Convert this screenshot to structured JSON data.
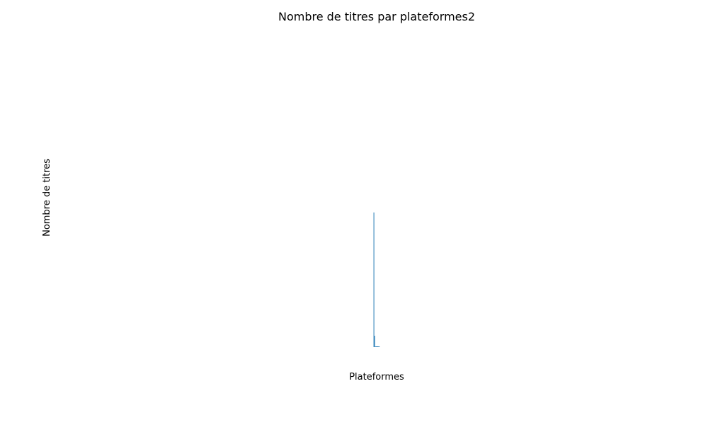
{
  "chart_data": {
    "type": "bar",
    "title": "Nombre de titres par plateformes2",
    "xlabel": "Plateformes",
    "ylabel": "Nombre de titres",
    "categories": [
      "",
      "",
      "",
      "",
      "",
      "",
      "",
      ""
    ],
    "values": [
      190,
      16,
      1,
      1,
      1,
      1,
      1,
      1
    ],
    "ylim": [
      0,
      190
    ],
    "grid": false,
    "bar_color": "#1f77b4"
  }
}
